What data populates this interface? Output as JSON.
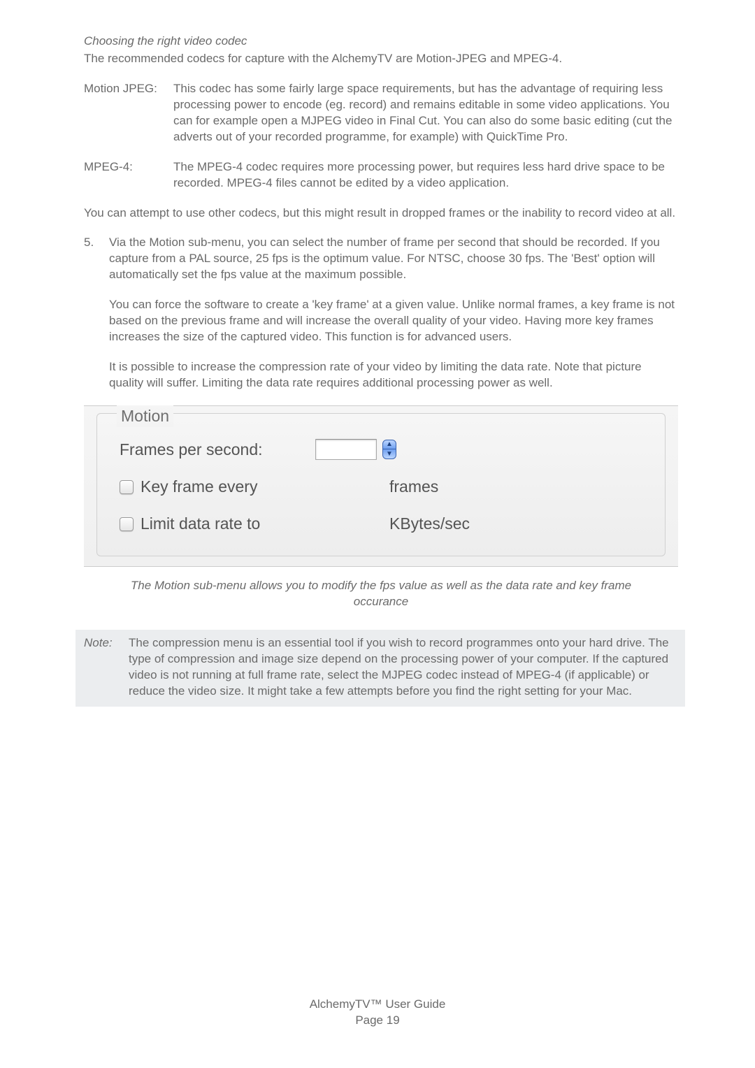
{
  "heading": {
    "subheading": "Choosing the right video codec",
    "intro": "The recommended codecs for capture with the AlchemyTV are Motion-JPEG and MPEG-4."
  },
  "codecs": {
    "mjpeg": {
      "label": "Motion JPEG:",
      "body": "This codec has some fairly large space requirements, but has the advantage of requiring less processing power to encode (eg. record) and remains editable in some video applications. You can for example open a MJPEG video in Final Cut. You can also do some basic editing (cut the adverts out of your recorded programme, for example) with QuickTime Pro."
    },
    "mpeg4": {
      "label": "MPEG-4:",
      "body": "The MPEG-4 codec requires more processing power, but requires less hard drive space to be recorded. MPEG-4 files cannot be edited by a video application."
    }
  },
  "warning": "You can attempt to use other codecs, but this might result in dropped frames or the inability to record video at all.",
  "step5": {
    "num": "5.",
    "p1": "Via the Motion sub-menu, you can select the number of frame per second that should be recorded. If you capture from a PAL source, 25 fps is the optimum value. For NTSC, choose 30 fps. The 'Best' option will automatically set the fps value at the maximum possible.",
    "p2": "You can force the software to create a 'key frame' at a given value. Unlike normal frames, a key frame is not based on the previous frame and will increase the overall quality of your video. Having more key frames increases the size of the captured video. This function is for advanced users.",
    "p3": "It is possible to increase the compression rate of your video by limiting the data rate. Note that picture quality will suffer. Limiting the data  rate requires additional processing power as well."
  },
  "motion_panel": {
    "title": "Motion",
    "fps_label": "Frames per second:",
    "keyframe_label": "Key frame every",
    "keyframe_unit": "frames",
    "limit_label": "Limit data rate to",
    "limit_unit": "KBytes/sec"
  },
  "caption": "The Motion sub-menu allows you to modify the fps value as well as the data rate and key frame occurance",
  "note": {
    "label": "Note:",
    "body": "The compression menu is an essential tool if you wish to record programmes onto your hard drive. The type of compression and image size depend on the processing power of your computer. If the captured video is not running at full frame rate, select the MJPEG codec instead of MPEG-4 (if applicable) or reduce the video size. It might take a few attempts before you find the right setting for your Mac."
  },
  "footer": {
    "title": "AlchemyTV™ User Guide",
    "page_label": "Page ",
    "page_num": "19"
  }
}
